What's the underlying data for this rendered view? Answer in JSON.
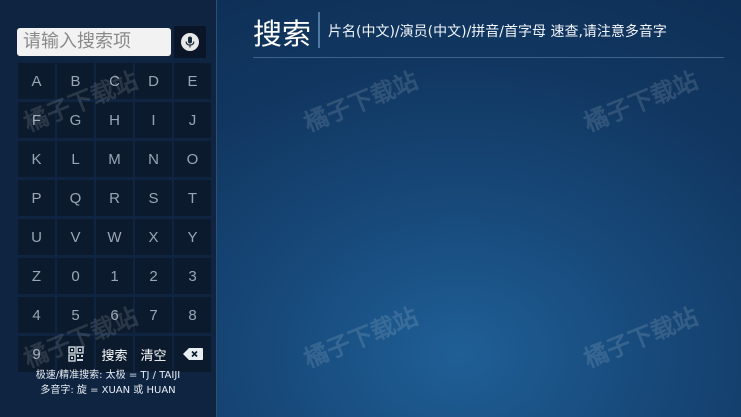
{
  "search": {
    "placeholder": "请输入搜索项",
    "voice_icon": "microphone-icon"
  },
  "keypad": {
    "keys": [
      "A",
      "B",
      "C",
      "D",
      "E",
      "F",
      "G",
      "H",
      "I",
      "J",
      "K",
      "L",
      "M",
      "N",
      "O",
      "P",
      "Q",
      "R",
      "S",
      "T",
      "U",
      "V",
      "W",
      "X",
      "Y",
      "Z",
      "0",
      "1",
      "2",
      "3",
      "4",
      "5",
      "6",
      "7",
      "8"
    ],
    "bottom_row": {
      "key_9": "9",
      "qr_icon": "qr-code-icon",
      "search_label": "搜索",
      "clear_label": "清空",
      "backspace_icon": "backspace-icon"
    }
  },
  "hints": {
    "line1": "极速/精准搜索: 太极 = TJ / TAIJI",
    "line2": "多音字: 旋 = XUAN 或 HUAN"
  },
  "header": {
    "title": "搜索",
    "tip": "片名(中文)/演员(中文)/拼音/首字母 速查,请注意多音字"
  },
  "watermark": {
    "text": "橘子下载站"
  },
  "colors": {
    "background": "#113761",
    "sidebar": "#0f2440",
    "key": "#0b1a2c"
  }
}
